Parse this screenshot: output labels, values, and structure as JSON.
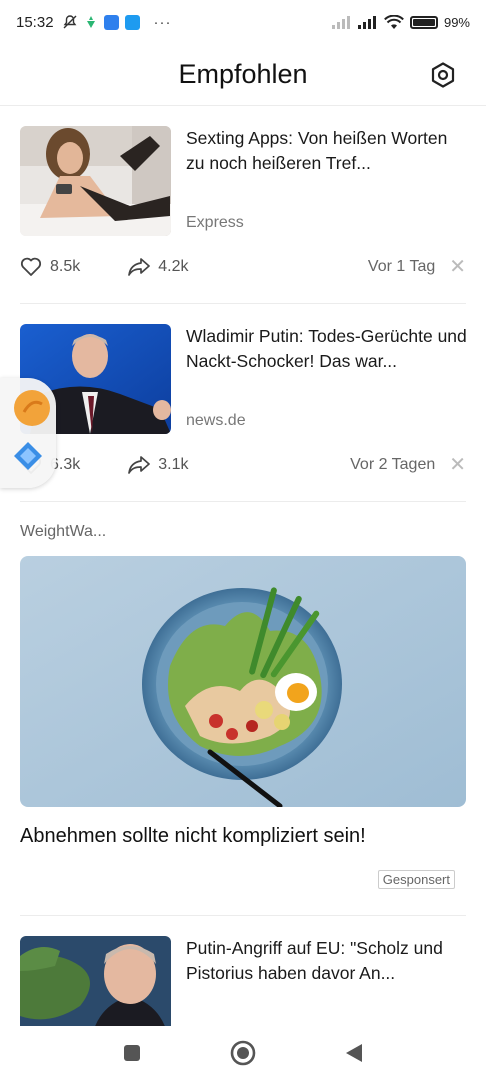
{
  "status_bar": {
    "time": "15:32",
    "dots": "···",
    "battery": "99%"
  },
  "header": {
    "title": "Empfohlen",
    "settings_icon": "settings-icon"
  },
  "feed": {
    "articles": [
      {
        "headline": "Sexting Apps: Von heißen Worten zu noch heißeren Tref...",
        "source": "Express",
        "likes": "8.5k",
        "shares": "4.2k",
        "time_ago": "Vor 1 Tag"
      },
      {
        "headline": "Wladimir Putin: Todes-Gerüchte und Nackt-Schocker! Das war...",
        "source": "news.de",
        "likes": "6.3k",
        "shares": "3.1k",
        "time_ago": "Vor 2 Tagen"
      },
      {
        "headline": "Putin-Angriff auf EU: \"Scholz und Pistorius haben davor An..."
      }
    ],
    "ad": {
      "source": "WeightWa...",
      "title": "Abnehmen sollte nicht kompliziert sein!",
      "badge": "Gesponsert"
    }
  },
  "colors": {
    "accent": "#1a1a1a",
    "muted": "#777777",
    "divider": "#ececec"
  }
}
